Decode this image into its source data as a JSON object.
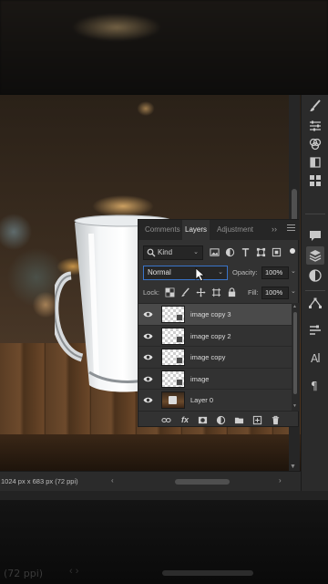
{
  "panel": {
    "tabs": [
      "Comments",
      "Layers",
      "Adjustment"
    ],
    "tab_more": "››",
    "filter": {
      "kind_label": "Kind",
      "icons": [
        "image-filter-icon",
        "adjustment-filter-icon",
        "type-filter-icon",
        "shape-filter-icon",
        "smart-object-filter-icon"
      ]
    },
    "blend_mode": "Normal",
    "opacity_label": "Opacity:",
    "opacity_value": "100%",
    "lock_label": "Lock:",
    "fill_label": "Fill:",
    "fill_value": "100%",
    "layers": [
      {
        "name": "image copy 3",
        "selected": true,
        "thumb": "smart-object"
      },
      {
        "name": "image copy 2",
        "selected": false,
        "thumb": "smart-object"
      },
      {
        "name": "image copy",
        "selected": false,
        "thumb": "smart-object"
      },
      {
        "name": "image",
        "selected": false,
        "thumb": "smart-object"
      },
      {
        "name": "Layer 0",
        "selected": false,
        "thumb": "photo"
      }
    ],
    "footer": {
      "fx_label": "fx"
    }
  },
  "status": {
    "doc_info": "1024 px x 683 px (72 ppi)",
    "ghost_info": "(72 ppi)"
  },
  "colors": {
    "panel_bg": "#323232",
    "selected_row": "#4a4a4a",
    "accent_focus": "#3a74c8"
  }
}
